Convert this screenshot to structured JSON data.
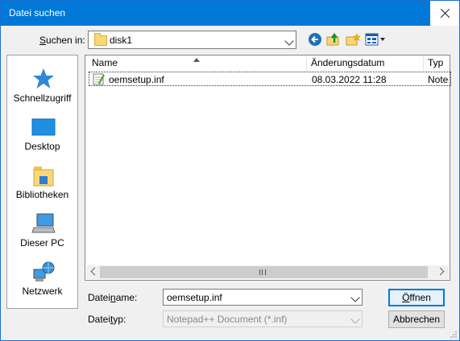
{
  "window": {
    "title": "Datei suchen"
  },
  "location": {
    "label": "Suchen in:",
    "label_key": "S",
    "label_rest": "uchen in:",
    "value": "disk1"
  },
  "sidebar": {
    "items": [
      {
        "label": "Schnellzugriff",
        "icon": "star-icon"
      },
      {
        "label": "Desktop",
        "icon": "desktop-icon"
      },
      {
        "label": "Bibliotheken",
        "icon": "library-icon"
      },
      {
        "label": "Dieser PC",
        "icon": "computer-icon"
      },
      {
        "label": "Netzwerk",
        "icon": "network-icon"
      }
    ]
  },
  "file_list": {
    "columns": [
      "Name",
      "Änderungsdatum",
      "Typ"
    ],
    "rows": [
      {
        "name": "oemsetup.inf",
        "modified": "08.03.2022 11:28",
        "type": "Notep"
      }
    ]
  },
  "filename": {
    "label_pre": "Datei",
    "label_key": "n",
    "label_post": "ame:",
    "value": "oemsetup.inf"
  },
  "filetype": {
    "label_pre": "Datei",
    "label_key": "t",
    "label_post": "yp:",
    "value": "Notepad++ Document (*.inf)"
  },
  "buttons": {
    "open_key": "Ö",
    "open_rest": "ffnen",
    "cancel": "Abbrechen"
  },
  "colors": {
    "titlebar": "#0078d7",
    "accent": "#1a6fd6"
  }
}
